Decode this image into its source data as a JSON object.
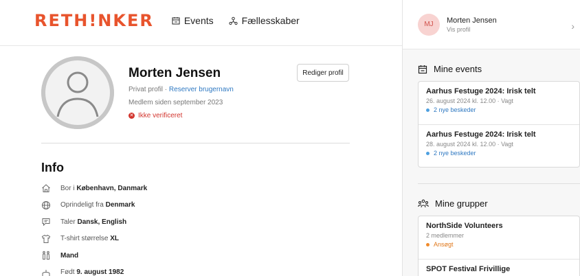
{
  "brand": {
    "logo": "RETH!NKER",
    "accent": "#e8542d"
  },
  "nav": [
    {
      "label": "Events",
      "icon": "calendar-icon"
    },
    {
      "label": "Fællesskaber",
      "icon": "community-icon"
    }
  ],
  "profile": {
    "name": "Morten Jensen",
    "privacy": "Privat profil · ",
    "reserve_link": "Reserver brugernavn",
    "member_since": "Medlem siden september 2023",
    "verification": "Ikke verificeret",
    "edit_label": "Rediger profil"
  },
  "info": {
    "title": "Info",
    "rows": [
      {
        "icon": "home-icon",
        "prefix": "Bor i ",
        "value": "København, Danmark"
      },
      {
        "icon": "globe-icon",
        "prefix": "Oprindeligt fra ",
        "value": "Denmark"
      },
      {
        "icon": "speech-icon",
        "prefix": "Taler ",
        "value": "Dansk, English"
      },
      {
        "icon": "tshirt-icon",
        "prefix": "T-shirt størrelse ",
        "value": "XL"
      },
      {
        "icon": "gender-icon",
        "prefix": "",
        "value": "Mand"
      },
      {
        "icon": "cake-icon",
        "prefix": "Født ",
        "value": "9. august 1982"
      }
    ]
  },
  "sidebar": {
    "user": {
      "initials": "MJ",
      "name": "Morten Jensen",
      "sub": "Vis profil"
    },
    "events": {
      "title": "Mine events",
      "items": [
        {
          "title": "Aarhus Festuge 2024: Irisk telt",
          "sub": "26. august 2024 kl. 12.00 · Vagt",
          "note": "2 nye beskeder"
        },
        {
          "title": "Aarhus Festuge 2024: Irisk telt",
          "sub": "28. august 2024 kl. 12.00 · Vagt",
          "note": "2 nye beskeder"
        }
      ]
    },
    "groups": {
      "title": "Mine grupper",
      "items": [
        {
          "title": "NorthSide Volunteers",
          "sub": "2 medlemmer",
          "note": "Ansøgt"
        },
        {
          "title": "SPOT Festival Frivillige"
        }
      ]
    }
  }
}
